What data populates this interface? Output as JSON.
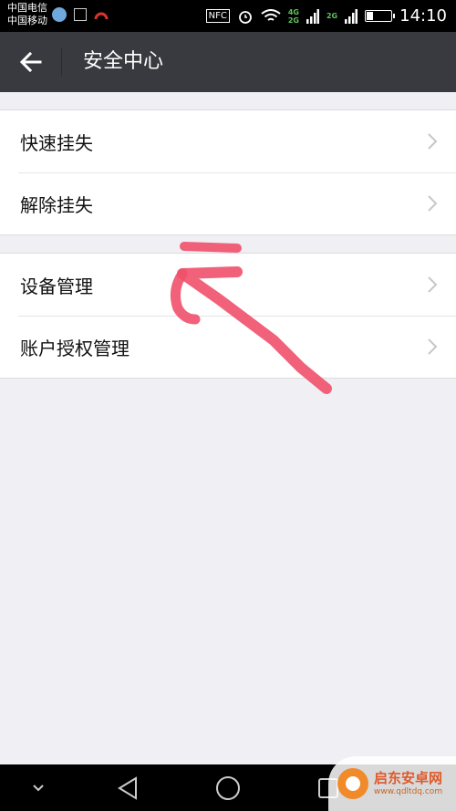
{
  "status_bar": {
    "carrier_1": "中国电信",
    "carrier_2": "中国移动",
    "nfc": "NFC",
    "net_1": "4G",
    "net_2": "2G",
    "net_3": "2G",
    "time": "14:10",
    "battery_level": 0.3
  },
  "header": {
    "title": "安全中心",
    "back_icon": "arrow-left-icon"
  },
  "groups": [
    {
      "items": [
        {
          "label": "快速挂失",
          "icon": "chevron-right-icon"
        },
        {
          "label": "解除挂失",
          "icon": "chevron-right-icon"
        }
      ]
    },
    {
      "items": [
        {
          "label": "设备管理",
          "icon": "chevron-right-icon"
        },
        {
          "label": "账户授权管理",
          "icon": "chevron-right-icon"
        }
      ]
    }
  ],
  "nav_bar": {
    "buttons": [
      "chevron-down-icon",
      "back-triangle-icon",
      "home-circle-icon",
      "recents-square-icon"
    ]
  },
  "watermark": {
    "name": "启东安卓网",
    "url": "www.qdltdq.com"
  },
  "colors": {
    "header_bg": "#393a3f",
    "page_bg": "#efeff4",
    "annotation": "#f0506a"
  }
}
